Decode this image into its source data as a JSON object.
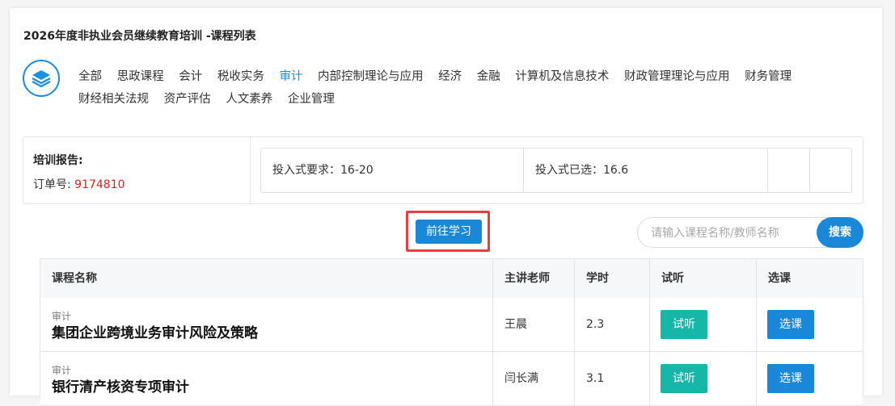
{
  "page": {
    "title": "2026年度非执业会员继续教育培训 -课程列表"
  },
  "categories": [
    {
      "label": "全部",
      "active": false
    },
    {
      "label": "思政课程",
      "active": false
    },
    {
      "label": "会计",
      "active": false
    },
    {
      "label": "税收实务",
      "active": false
    },
    {
      "label": "审计",
      "active": true
    },
    {
      "label": "内部控制理论与应用",
      "active": false
    },
    {
      "label": "经济",
      "active": false
    },
    {
      "label": "金融",
      "active": false
    },
    {
      "label": "计算机及信息技术",
      "active": false
    },
    {
      "label": "财政管理理论与应用",
      "active": false
    },
    {
      "label": "财务管理",
      "active": false
    },
    {
      "label": "财经相关法规",
      "active": false
    },
    {
      "label": "资产评估",
      "active": false
    },
    {
      "label": "人文素养",
      "active": false
    },
    {
      "label": "企业管理",
      "active": false
    }
  ],
  "report": {
    "label": "培训报告:",
    "order_label": "订单号: ",
    "order_number": "9174810",
    "requirement": "投入式要求：16-20",
    "selected": "投入式已选：16.6"
  },
  "actions": {
    "go_study": "前往学习",
    "search_placeholder": "请输入课程名称/教师名称",
    "search_button": "搜索"
  },
  "table": {
    "headers": [
      "课程名称",
      "主讲老师",
      "学时",
      "试听",
      "选课"
    ],
    "rows": [
      {
        "tag": "审计",
        "name": "集团企业跨境业务审计风险及策略",
        "teacher": "王晨",
        "hours": "2.3",
        "listen": "试听",
        "select": "选课"
      },
      {
        "tag": "审计",
        "name": "银行清产核资专项审计",
        "teacher": "闫长满",
        "hours": "3.1",
        "listen": "试听",
        "select": "选课"
      }
    ]
  },
  "colors": {
    "accent": "#1a88d9",
    "listen_button": "#16b6a8",
    "order_number": "#e02020",
    "highlight_border": "#ea3d41"
  }
}
